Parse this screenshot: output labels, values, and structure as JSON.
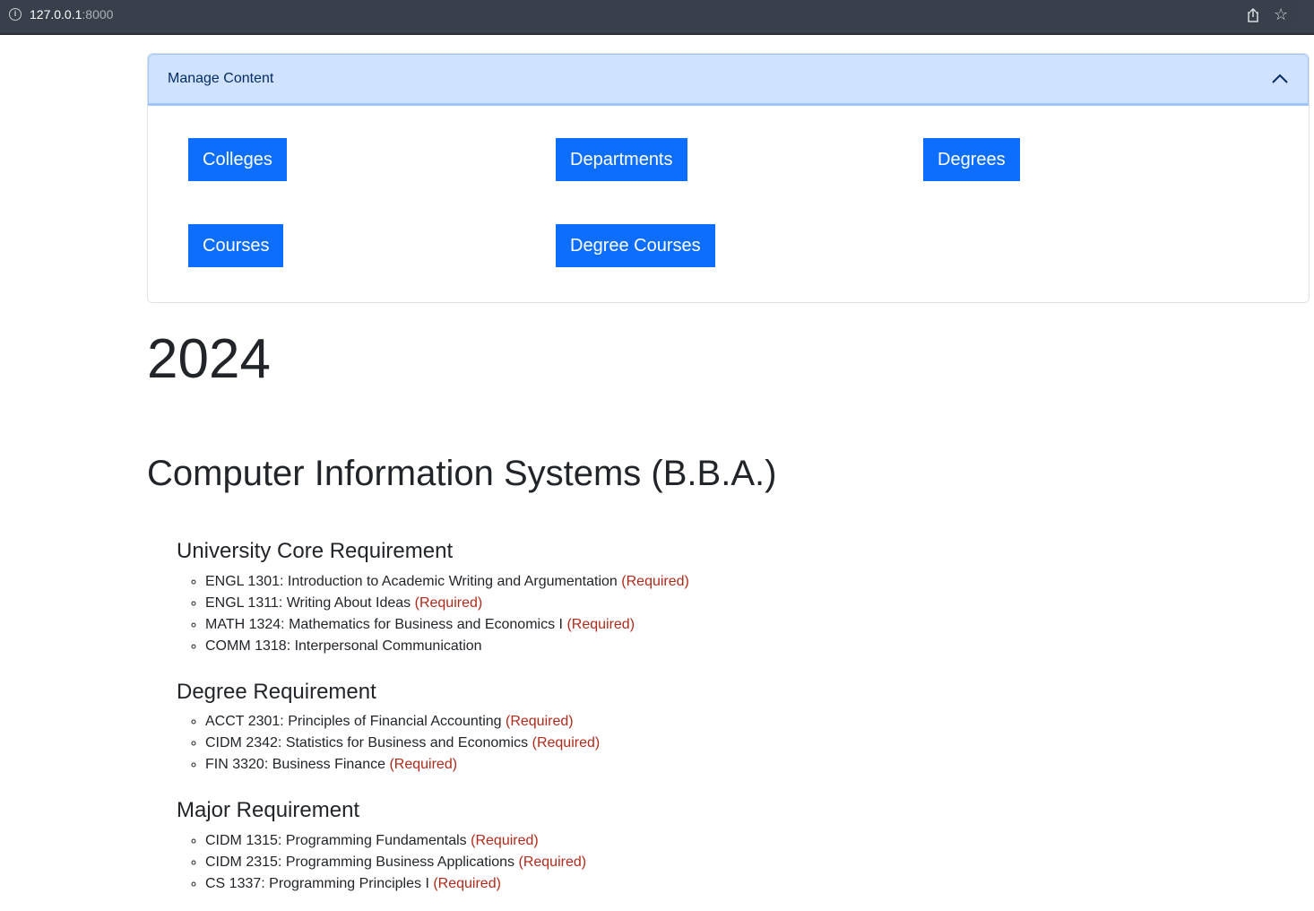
{
  "browser": {
    "url_host": "127.0.0.1",
    "url_port": ":8000"
  },
  "accordion": {
    "title": "Manage Content",
    "buttons": [
      "Colleges",
      "Departments",
      "Degrees",
      "Courses",
      "Degree Courses"
    ]
  },
  "year": "2024",
  "degree": "Computer Information Systems (B.B.A.)",
  "sections": [
    {
      "title": "University Core Requirement",
      "courses": [
        {
          "text": "ENGL 1301: Introduction to Academic Writing and Argumentation",
          "tag": "(Required)"
        },
        {
          "text": "ENGL 1311: Writing About Ideas",
          "tag": "(Required)"
        },
        {
          "text": "MATH 1324: Mathematics for Business and Economics I",
          "tag": "(Required)"
        },
        {
          "text": "COMM 1318: Interpersonal Communication",
          "tag": ""
        }
      ]
    },
    {
      "title": "Degree Requirement",
      "courses": [
        {
          "text": "ACCT 2301: Principles of Financial Accounting",
          "tag": "(Required)"
        },
        {
          "text": "CIDM 2342: Statistics for Business and Economics",
          "tag": "(Required)"
        },
        {
          "text": "FIN 3320: Business Finance",
          "tag": "(Required)"
        }
      ]
    },
    {
      "title": "Major Requirement",
      "courses": [
        {
          "text": "CIDM 1315: Programming Fundamentals",
          "tag": "(Required)"
        },
        {
          "text": "CIDM 2315: Programming Business Applications",
          "tag": "(Required)"
        },
        {
          "text": "CS 1337: Programming Principles I",
          "tag": "(Required)"
        }
      ]
    }
  ],
  "colors": {
    "primary": "#0d6efd",
    "accordion_header_bg": "#cfe2ff",
    "required": "#b02a1a"
  }
}
